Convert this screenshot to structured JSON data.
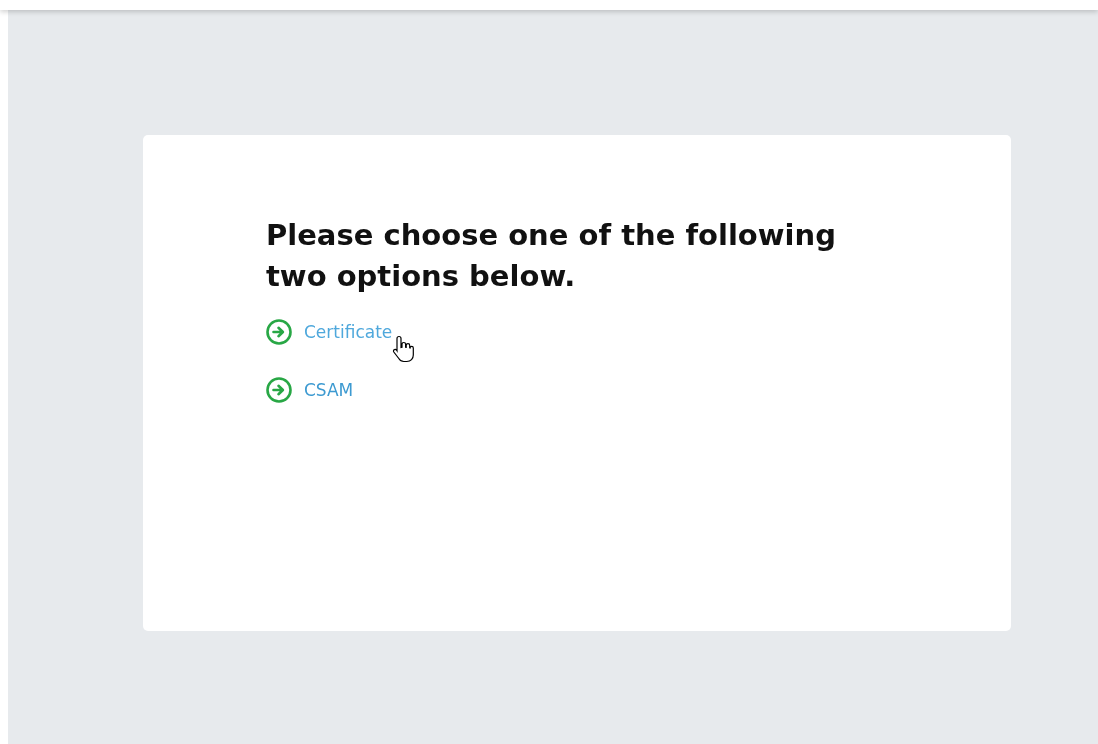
{
  "card": {
    "heading": "Please choose one of the following two options below.",
    "options": [
      {
        "label": "Certificate",
        "hovered": true
      },
      {
        "label": "CSAM",
        "hovered": false
      }
    ]
  }
}
